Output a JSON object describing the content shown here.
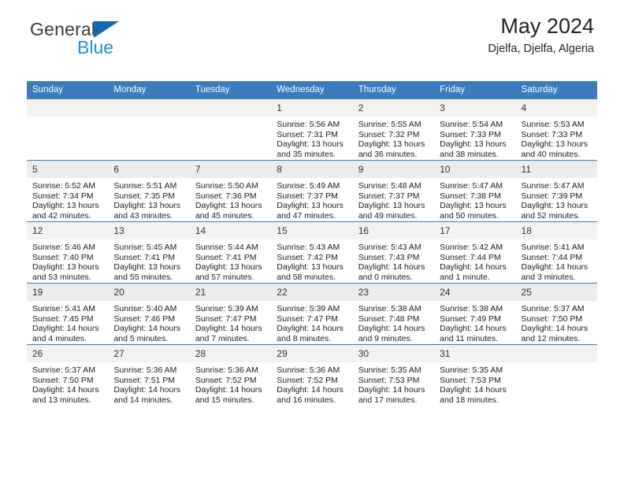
{
  "brand": {
    "name_top": "General",
    "name_bottom": "Blue",
    "accent_blue": "#1a8fdd",
    "triangle_blue": "#1268b3"
  },
  "header": {
    "title": "May 2024",
    "subtitle": "Djelfa, Djelfa, Algeria"
  },
  "calendar": {
    "header_bg": "#3a7cbe",
    "weekdays": [
      "Sunday",
      "Monday",
      "Tuesday",
      "Wednesday",
      "Thursday",
      "Friday",
      "Saturday"
    ],
    "weeks": [
      [
        {
          "day": "",
          "sunrise": "",
          "sunset": "",
          "daylight_1": "",
          "daylight_2": "",
          "empty": true
        },
        {
          "day": "",
          "sunrise": "",
          "sunset": "",
          "daylight_1": "",
          "daylight_2": "",
          "empty": true
        },
        {
          "day": "",
          "sunrise": "",
          "sunset": "",
          "daylight_1": "",
          "daylight_2": "",
          "empty": true
        },
        {
          "day": "1",
          "sunrise": "Sunrise: 5:56 AM",
          "sunset": "Sunset: 7:31 PM",
          "daylight_1": "Daylight: 13 hours",
          "daylight_2": "and 35 minutes.",
          "empty": false
        },
        {
          "day": "2",
          "sunrise": "Sunrise: 5:55 AM",
          "sunset": "Sunset: 7:32 PM",
          "daylight_1": "Daylight: 13 hours",
          "daylight_2": "and 36 minutes.",
          "empty": false
        },
        {
          "day": "3",
          "sunrise": "Sunrise: 5:54 AM",
          "sunset": "Sunset: 7:33 PM",
          "daylight_1": "Daylight: 13 hours",
          "daylight_2": "and 38 minutes.",
          "empty": false
        },
        {
          "day": "4",
          "sunrise": "Sunrise: 5:53 AM",
          "sunset": "Sunset: 7:33 PM",
          "daylight_1": "Daylight: 13 hours",
          "daylight_2": "and 40 minutes.",
          "empty": false
        }
      ],
      [
        {
          "day": "5",
          "sunrise": "Sunrise: 5:52 AM",
          "sunset": "Sunset: 7:34 PM",
          "daylight_1": "Daylight: 13 hours",
          "daylight_2": "and 42 minutes.",
          "empty": false
        },
        {
          "day": "6",
          "sunrise": "Sunrise: 5:51 AM",
          "sunset": "Sunset: 7:35 PM",
          "daylight_1": "Daylight: 13 hours",
          "daylight_2": "and 43 minutes.",
          "empty": false
        },
        {
          "day": "7",
          "sunrise": "Sunrise: 5:50 AM",
          "sunset": "Sunset: 7:36 PM",
          "daylight_1": "Daylight: 13 hours",
          "daylight_2": "and 45 minutes.",
          "empty": false
        },
        {
          "day": "8",
          "sunrise": "Sunrise: 5:49 AM",
          "sunset": "Sunset: 7:37 PM",
          "daylight_1": "Daylight: 13 hours",
          "daylight_2": "and 47 minutes.",
          "empty": false
        },
        {
          "day": "9",
          "sunrise": "Sunrise: 5:48 AM",
          "sunset": "Sunset: 7:37 PM",
          "daylight_1": "Daylight: 13 hours",
          "daylight_2": "and 49 minutes.",
          "empty": false
        },
        {
          "day": "10",
          "sunrise": "Sunrise: 5:47 AM",
          "sunset": "Sunset: 7:38 PM",
          "daylight_1": "Daylight: 13 hours",
          "daylight_2": "and 50 minutes.",
          "empty": false
        },
        {
          "day": "11",
          "sunrise": "Sunrise: 5:47 AM",
          "sunset": "Sunset: 7:39 PM",
          "daylight_1": "Daylight: 13 hours",
          "daylight_2": "and 52 minutes.",
          "empty": false
        }
      ],
      [
        {
          "day": "12",
          "sunrise": "Sunrise: 5:46 AM",
          "sunset": "Sunset: 7:40 PM",
          "daylight_1": "Daylight: 13 hours",
          "daylight_2": "and 53 minutes.",
          "empty": false
        },
        {
          "day": "13",
          "sunrise": "Sunrise: 5:45 AM",
          "sunset": "Sunset: 7:41 PM",
          "daylight_1": "Daylight: 13 hours",
          "daylight_2": "and 55 minutes.",
          "empty": false
        },
        {
          "day": "14",
          "sunrise": "Sunrise: 5:44 AM",
          "sunset": "Sunset: 7:41 PM",
          "daylight_1": "Daylight: 13 hours",
          "daylight_2": "and 57 minutes.",
          "empty": false
        },
        {
          "day": "15",
          "sunrise": "Sunrise: 5:43 AM",
          "sunset": "Sunset: 7:42 PM",
          "daylight_1": "Daylight: 13 hours",
          "daylight_2": "and 58 minutes.",
          "empty": false
        },
        {
          "day": "16",
          "sunrise": "Sunrise: 5:43 AM",
          "sunset": "Sunset: 7:43 PM",
          "daylight_1": "Daylight: 14 hours",
          "daylight_2": "and 0 minutes.",
          "empty": false
        },
        {
          "day": "17",
          "sunrise": "Sunrise: 5:42 AM",
          "sunset": "Sunset: 7:44 PM",
          "daylight_1": "Daylight: 14 hours",
          "daylight_2": "and 1 minute.",
          "empty": false
        },
        {
          "day": "18",
          "sunrise": "Sunrise: 5:41 AM",
          "sunset": "Sunset: 7:44 PM",
          "daylight_1": "Daylight: 14 hours",
          "daylight_2": "and 3 minutes.",
          "empty": false
        }
      ],
      [
        {
          "day": "19",
          "sunrise": "Sunrise: 5:41 AM",
          "sunset": "Sunset: 7:45 PM",
          "daylight_1": "Daylight: 14 hours",
          "daylight_2": "and 4 minutes.",
          "empty": false
        },
        {
          "day": "20",
          "sunrise": "Sunrise: 5:40 AM",
          "sunset": "Sunset: 7:46 PM",
          "daylight_1": "Daylight: 14 hours",
          "daylight_2": "and 5 minutes.",
          "empty": false
        },
        {
          "day": "21",
          "sunrise": "Sunrise: 5:39 AM",
          "sunset": "Sunset: 7:47 PM",
          "daylight_1": "Daylight: 14 hours",
          "daylight_2": "and 7 minutes.",
          "empty": false
        },
        {
          "day": "22",
          "sunrise": "Sunrise: 5:39 AM",
          "sunset": "Sunset: 7:47 PM",
          "daylight_1": "Daylight: 14 hours",
          "daylight_2": "and 8 minutes.",
          "empty": false
        },
        {
          "day": "23",
          "sunrise": "Sunrise: 5:38 AM",
          "sunset": "Sunset: 7:48 PM",
          "daylight_1": "Daylight: 14 hours",
          "daylight_2": "and 9 minutes.",
          "empty": false
        },
        {
          "day": "24",
          "sunrise": "Sunrise: 5:38 AM",
          "sunset": "Sunset: 7:49 PM",
          "daylight_1": "Daylight: 14 hours",
          "daylight_2": "and 11 minutes.",
          "empty": false
        },
        {
          "day": "25",
          "sunrise": "Sunrise: 5:37 AM",
          "sunset": "Sunset: 7:50 PM",
          "daylight_1": "Daylight: 14 hours",
          "daylight_2": "and 12 minutes.",
          "empty": false
        }
      ],
      [
        {
          "day": "26",
          "sunrise": "Sunrise: 5:37 AM",
          "sunset": "Sunset: 7:50 PM",
          "daylight_1": "Daylight: 14 hours",
          "daylight_2": "and 13 minutes.",
          "empty": false
        },
        {
          "day": "27",
          "sunrise": "Sunrise: 5:36 AM",
          "sunset": "Sunset: 7:51 PM",
          "daylight_1": "Daylight: 14 hours",
          "daylight_2": "and 14 minutes.",
          "empty": false
        },
        {
          "day": "28",
          "sunrise": "Sunrise: 5:36 AM",
          "sunset": "Sunset: 7:52 PM",
          "daylight_1": "Daylight: 14 hours",
          "daylight_2": "and 15 minutes.",
          "empty": false
        },
        {
          "day": "29",
          "sunrise": "Sunrise: 5:36 AM",
          "sunset": "Sunset: 7:52 PM",
          "daylight_1": "Daylight: 14 hours",
          "daylight_2": "and 16 minutes.",
          "empty": false
        },
        {
          "day": "30",
          "sunrise": "Sunrise: 5:35 AM",
          "sunset": "Sunset: 7:53 PM",
          "daylight_1": "Daylight: 14 hours",
          "daylight_2": "and 17 minutes.",
          "empty": false
        },
        {
          "day": "31",
          "sunrise": "Sunrise: 5:35 AM",
          "sunset": "Sunset: 7:53 PM",
          "daylight_1": "Daylight: 14 hours",
          "daylight_2": "and 18 minutes.",
          "empty": false
        },
        {
          "day": "",
          "sunrise": "",
          "sunset": "",
          "daylight_1": "",
          "daylight_2": "",
          "empty": true
        }
      ]
    ]
  }
}
